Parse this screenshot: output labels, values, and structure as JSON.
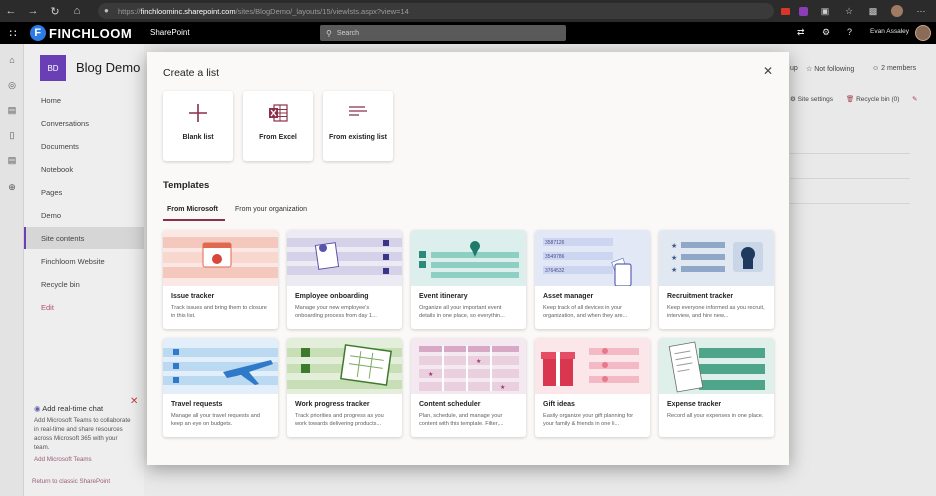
{
  "browser": {
    "url_scheme": "https://",
    "url_host": "finchloominc.sharepoint.com",
    "url_path": "/sites/BlogDemo/_layouts/15/viewlsts.aspx?view=14"
  },
  "suite": {
    "brand": "FINCHLOOM",
    "app_name": "SharePoint",
    "search_placeholder": "Search",
    "user_name": "Evan Assaley"
  },
  "site": {
    "logo_text": "BD",
    "title": "Blog Demo",
    "follow_label": "Not following",
    "members_label": "2 members",
    "site_settings_label": "Site settings",
    "recycle_label": "Recycle bin (0)"
  },
  "left_nav": {
    "items": [
      {
        "label": "Home"
      },
      {
        "label": "Conversations"
      },
      {
        "label": "Documents"
      },
      {
        "label": "Notebook"
      },
      {
        "label": "Pages"
      },
      {
        "label": "Demo"
      },
      {
        "label": "Site contents"
      },
      {
        "label": "Finchloom Website"
      },
      {
        "label": "Recycle bin"
      },
      {
        "label": "Edit"
      }
    ],
    "active_index": 6
  },
  "teams_prompt": {
    "title": "Add real-time chat",
    "text": "Add Microsoft Teams to collaborate in real-time and share resources across Microsoft 365 with your team.",
    "link": "Add Microsoft Teams"
  },
  "classic_link": "Return to classic SharePoint",
  "modal": {
    "title": "Create a list",
    "create_options": [
      {
        "label": "Blank list",
        "icon": "plus-icon"
      },
      {
        "label": "From Excel",
        "icon": "excel-icon"
      },
      {
        "label": "From existing list",
        "icon": "list-lines-icon"
      }
    ],
    "templates_title": "Templates",
    "tabs": [
      {
        "label": "From Microsoft",
        "selected": true
      },
      {
        "label": "From your organization",
        "selected": false
      }
    ],
    "templates": [
      {
        "name": "Issue tracker",
        "desc": "Track issues and bring them to closure in this list."
      },
      {
        "name": "Employee onboarding",
        "desc": "Manage your new employee's onboarding process from day 1..."
      },
      {
        "name": "Event itinerary",
        "desc": "Organize all your important event details in one place, so everythin..."
      },
      {
        "name": "Asset manager",
        "desc": "Keep track of all devices in your organization, and when they are..."
      },
      {
        "name": "Recruitment tracker",
        "desc": "Keep everyone informed as you recruit, interview, and hire new..."
      },
      {
        "name": "Travel requests",
        "desc": "Manage all your travel requests and keep an eye on budgets."
      },
      {
        "name": "Work progress tracker",
        "desc": "Track priorities and progress as you work towards delivering products..."
      },
      {
        "name": "Content scheduler",
        "desc": "Plan, schedule, and manage your content with this template. Filter,..."
      },
      {
        "name": "Gift ideas",
        "desc": "Easily organize your gift planning for your family & friends in one li..."
      },
      {
        "name": "Expense tracker",
        "desc": "Record all your expenses in one place."
      }
    ],
    "asset_numbers": [
      "3587126",
      "3549786",
      "3764532"
    ]
  },
  "colors": {
    "accent": "#8c2f4a",
    "site_logo": "#6a3fb5",
    "brand_blue": "#2d7be5"
  }
}
